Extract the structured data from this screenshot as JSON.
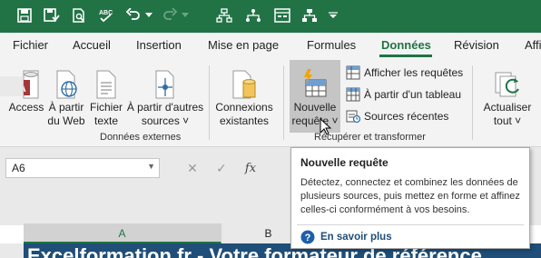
{
  "quick_access": {
    "icons": [
      "save-icon",
      "save-online-icon",
      "print-preview-icon",
      "spelling-icon",
      "undo-icon",
      "redo-icon",
      "org-chart-icon",
      "form-icon",
      "hierarchy-icon",
      "customize-dropdown-icon"
    ]
  },
  "tabs": [
    {
      "label": "Fichier"
    },
    {
      "label": "Accueil"
    },
    {
      "label": "Insertion"
    },
    {
      "label": "Mise en page"
    },
    {
      "label": "Formules"
    },
    {
      "label": "Données"
    },
    {
      "label": "Révision"
    },
    {
      "label": "Affi"
    }
  ],
  "ribbon": {
    "external": {
      "group_label": "Données externes",
      "buttons": [
        {
          "label_1": "Access",
          "label_2": ""
        },
        {
          "label_1": "À partir",
          "label_2": "du Web"
        },
        {
          "label_1": "Fichier",
          "label_2": "texte"
        },
        {
          "label_1": "À partir d'autres",
          "label_2": "sources ˅"
        },
        {
          "label_1": "Connexions",
          "label_2": "existantes"
        }
      ]
    },
    "transform": {
      "group_label": "Récupérer et transformer",
      "new_query": {
        "label_1": "Nouvelle",
        "label_2": "requête ˅"
      },
      "small_buttons": [
        {
          "label": "Afficher les requêtes"
        },
        {
          "label": "À partir d'un tableau"
        },
        {
          "label": "Sources récentes"
        }
      ]
    },
    "refresh": {
      "label_1": "Actualiser",
      "label_2": "tout ˅"
    }
  },
  "formula_bar": {
    "name_box": "A6",
    "fx": "fx"
  },
  "columns": [
    "A",
    "B"
  ],
  "sheet_text": "Excelformation.fr - Votre formateur de référence",
  "tooltip": {
    "title": "Nouvelle requête",
    "body": "Détectez, connectez et combinez les données de plusieurs sources, puis mettez en forme et affinez celles-ci conformément à vos besoins.",
    "link": "En savoir plus"
  },
  "colors": {
    "excel_green": "#217346",
    "ribbon_bg": "#f3f3f3",
    "sheet_header_blue": "#1f4e78"
  }
}
